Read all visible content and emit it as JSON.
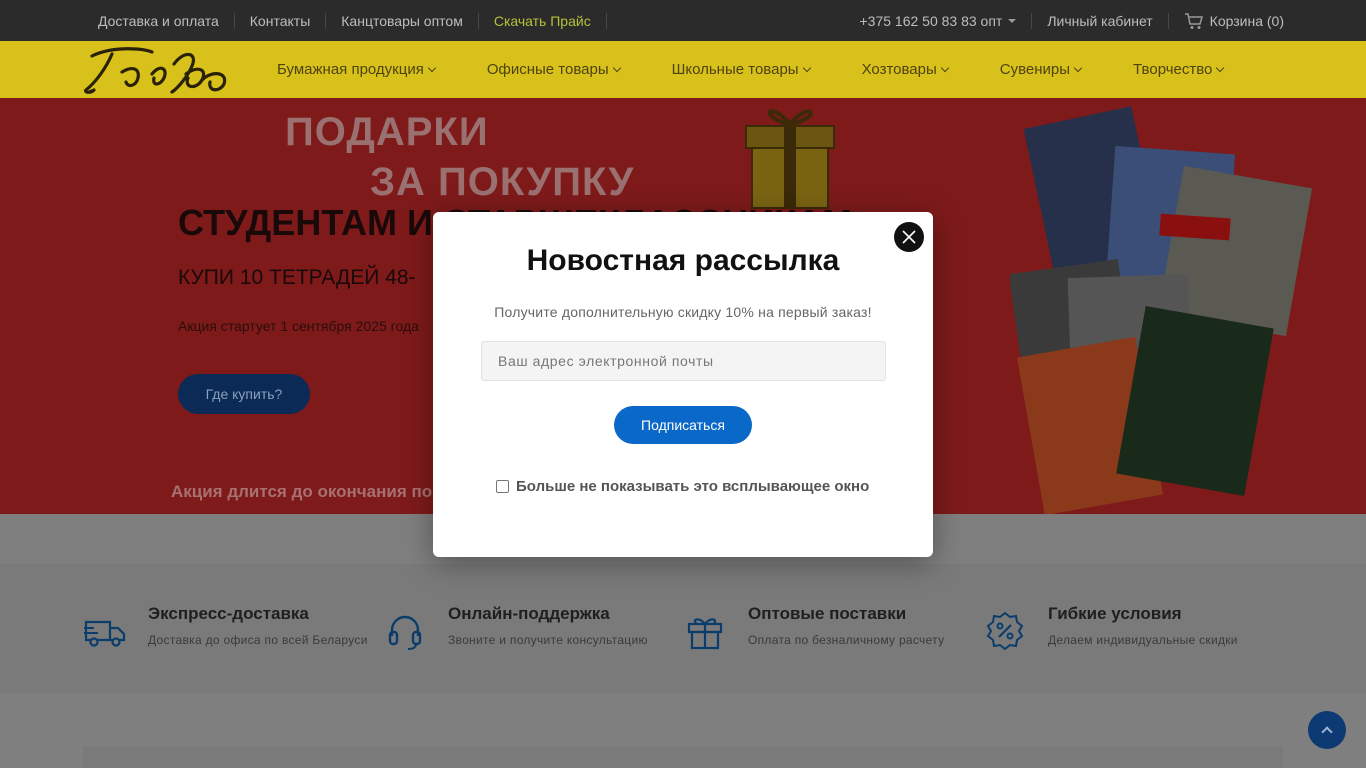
{
  "topbar": {
    "links": [
      "Доставка и оплата",
      "Контакты",
      "Канцтовары оптом",
      "Скачать Прайс"
    ],
    "phone": "+375 162 50 83 83 опт",
    "account": "Личный кабинет",
    "cart": "Корзина (0)"
  },
  "nav": {
    "items": [
      "Бумажная продукция",
      "Офисные товары",
      "Школьные товары",
      "Хозтовары",
      "Сувениры",
      "Творчество"
    ]
  },
  "hero": {
    "gift_line1": "ПОДАРКИ",
    "gift_line2": "ЗА ПОКУПКУ",
    "headline": "СТУДЕНТАМ И СТАРШЕКЛАССНИКАМ",
    "sub": "КУПИ 10 ТЕТРАДЕЙ 48-",
    "date": "Акция стартует 1 сентября 2025 года",
    "where_button": "Где купить?",
    "ends": "Акция длится до окончания по"
  },
  "features": [
    {
      "title": "Экспресс-доставка",
      "desc": "Доставка до офиса по всей Беларуси",
      "icon": "truck-icon"
    },
    {
      "title": "Онлайн-поддержка",
      "desc": "Звоните и получите консультацию",
      "icon": "headset-icon"
    },
    {
      "title": "Оптовые поставки",
      "desc": "Оплата по безналичному расчету",
      "icon": "gift-icon"
    },
    {
      "title": "Гибкие условия",
      "desc": "Делаем индивидуальные скидки",
      "icon": "discount-icon"
    }
  ],
  "modal": {
    "title": "Новостная рассылка",
    "lead": "Получите дополнительную скидку 10% на первый заказ!",
    "email_placeholder": "Ваш адрес электронной почты",
    "subscribe": "Подписаться",
    "dont_show": "Больше не показывать это всплывающее окно"
  },
  "colors": {
    "accent_blue": "#0a68c9",
    "nav_yellow": "#d9c11c",
    "hero_red": "#7e1a1a"
  }
}
